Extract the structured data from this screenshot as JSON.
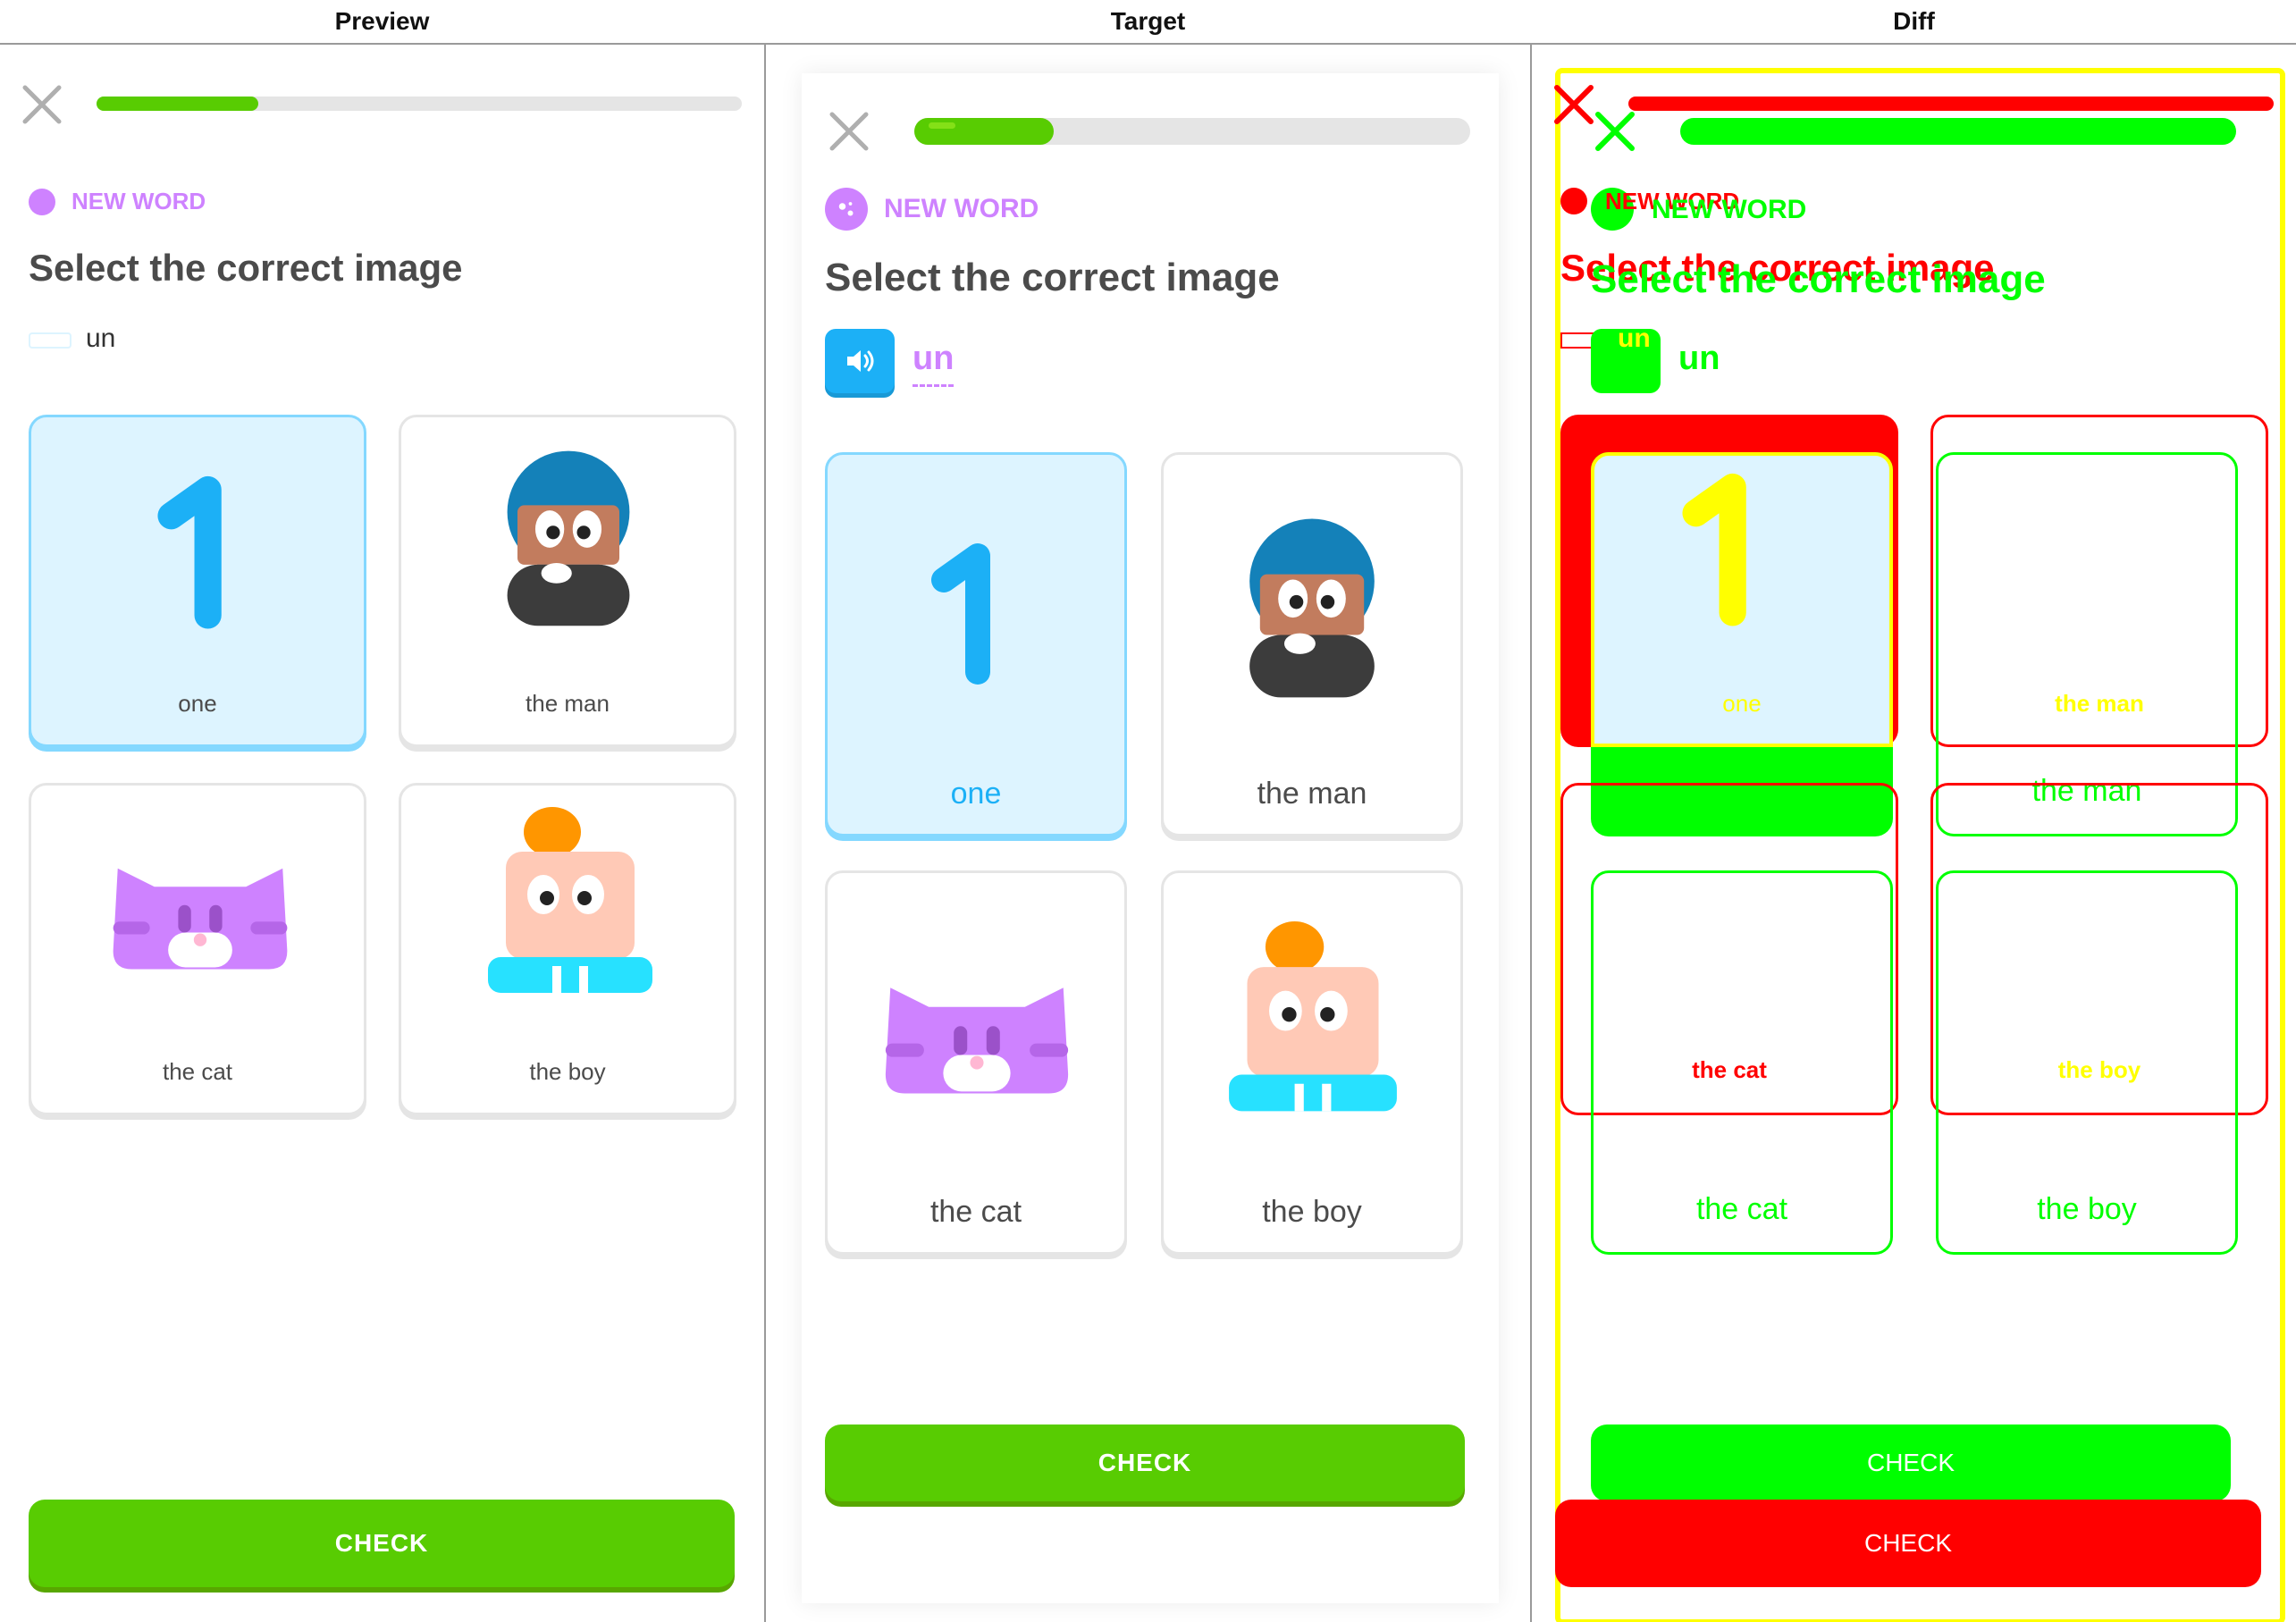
{
  "header": {
    "preview": "Preview",
    "target": "Target",
    "diff": "Diff"
  },
  "lesson": {
    "badge": "NEW WORD",
    "title": "Select the correct image",
    "word": "un",
    "progress": 0.25,
    "check_label": "CHECK",
    "options": [
      {
        "label": "one",
        "icon": "number-one-icon",
        "selected": true
      },
      {
        "label": "the man",
        "icon": "man-icon",
        "selected": false
      },
      {
        "label": "the cat",
        "icon": "cat-icon",
        "selected": false
      },
      {
        "label": "the boy",
        "icon": "boy-icon",
        "selected": false
      }
    ]
  },
  "colors": {
    "green": "#58cc02",
    "blue": "#1cb0f6",
    "purple": "#ce82ff",
    "selected_bg": "#ddf4ff"
  }
}
